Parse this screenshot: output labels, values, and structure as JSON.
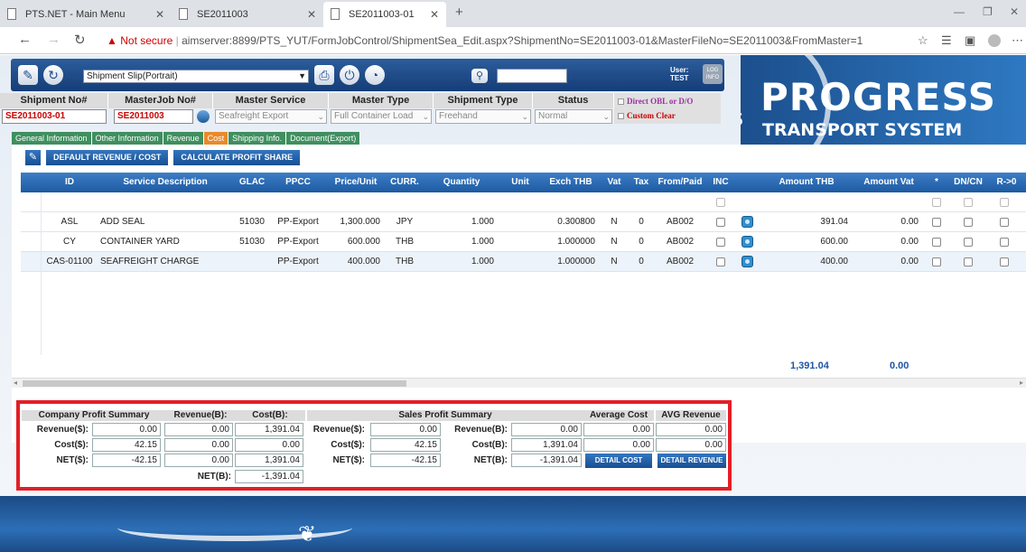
{
  "browser": {
    "tabs": [
      {
        "title": "PTS.NET - Main Menu"
      },
      {
        "title": "SE2011003"
      },
      {
        "title": "SE2011003-01"
      }
    ],
    "url_warning": "Not secure",
    "url": "aimserver:8899/PTS_YUT/FormJobControl/ShipmentSea_Edit.aspx?ShipmentNo=SE2011003-01&MasterFileNo=SE2011003&FromMaster=1"
  },
  "toolbar": {
    "slip_select": "Shipment Slip(Portrait)",
    "user_label": "User:",
    "user_name": "TEST",
    "log_info": "LOG INFO"
  },
  "header": {
    "labels": [
      "Shipment No#",
      "MasterJob No#",
      "Master Service",
      "Master Type",
      "Shipment Type",
      "Status"
    ],
    "shipment_no": "SE2011003-01",
    "masterjob_no": "SE2011003",
    "master_service": "Seafreight Export",
    "master_type": "Full Container Load",
    "shipment_type": "Freehand",
    "status": "Normal",
    "flag_obl": "Direct OBL or D/O",
    "flag_custom": "Custom Clear"
  },
  "logo": {
    "title": "PROGRESS",
    "subtitle": "TRANSPORT SYSTEM",
    "mark": "S"
  },
  "page_tabs": [
    "General Information",
    "Other Information",
    "Revenue",
    "Cost",
    "Shipping Info.",
    "Document(Export)"
  ],
  "cost_buttons": {
    "default": "DEFAULT REVENUE / COST",
    "calc": "CALCULATE PROFIT SHARE"
  },
  "grid": {
    "columns": [
      "ID",
      "Service Description",
      "GLAC",
      "PPCC",
      "Price/Unit",
      "CURR.",
      "Quantity",
      "Unit",
      "Exch THB",
      "Vat",
      "Tax",
      "From/Paid",
      "INC",
      "",
      "Amount THB",
      "Amount Vat",
      "*",
      "DN/CN",
      "R->0"
    ],
    "rows": [
      {
        "id": "ASL",
        "desc": "ADD SEAL",
        "glac": "51030",
        "ppcc": "PP-Export",
        "price": "1,300.000",
        "curr": "JPY",
        "qty": "1.000",
        "unit": "",
        "exch": "0.300800",
        "vat": "N",
        "tax": "0",
        "from": "AB002",
        "amount": "391.04",
        "amtvat": "0.00"
      },
      {
        "id": "CY",
        "desc": "CONTAINER YARD",
        "glac": "51030",
        "ppcc": "PP-Export",
        "price": "600.000",
        "curr": "THB",
        "qty": "1.000",
        "unit": "",
        "exch": "1.000000",
        "vat": "N",
        "tax": "0",
        "from": "AB002",
        "amount": "600.00",
        "amtvat": "0.00"
      },
      {
        "id": "CAS-01100",
        "desc": "SEAFREIGHT CHARGE",
        "glac": "",
        "ppcc": "PP-Export",
        "price": "400.000",
        "curr": "THB",
        "qty": "1.000",
        "unit": "",
        "exch": "1.000000",
        "vat": "N",
        "tax": "0",
        "from": "AB002",
        "amount": "400.00",
        "amtvat": "0.00"
      }
    ],
    "total_amount": "1,391.04",
    "total_vat": "0.00"
  },
  "summary": {
    "company_title": "Company Profit Summary",
    "revenue_b_hdr": "Revenue(B):",
    "cost_b_hdr": "Cost(B):",
    "sales_title": "Sales Profit Summary",
    "avg_cost_hdr": "Average Cost",
    "avg_rev_hdr": "AVG Revenue",
    "lbl_rev_s": "Revenue($):",
    "lbl_cost_s": "Cost($):",
    "lbl_net_s": "NET($):",
    "lbl_net_b": "NET(B):",
    "lbl_rev_b": "Revenue(B):",
    "lbl_cost_b": "Cost(B):",
    "c_rev_s": "0.00",
    "c_rev_b": "0.00",
    "c_cost_b1": "1,391.04",
    "c_cost_s": "42.15",
    "c_cost_b2": "0.00",
    "c_cost_b3": "0.00",
    "c_net_s": "-42.15",
    "c_net_b1": "0.00",
    "c_net_b2": "1,391.04",
    "c_net_b_total": "-1,391.04",
    "s_rev_s": "0.00",
    "s_rev_b": "0.00",
    "s_avg_cost1": "0.00",
    "s_avg_rev1": "0.00",
    "s_cost_s": "42.15",
    "s_cost_b": "1,391.04",
    "s_avg_cost2": "0.00",
    "s_avg_rev2": "0.00",
    "s_net_s": "-42.15",
    "s_net_b": "-1,391.04",
    "btn_detail_cost": "DETAIL COST",
    "btn_detail_rev": "DETAIL REVENUE"
  }
}
